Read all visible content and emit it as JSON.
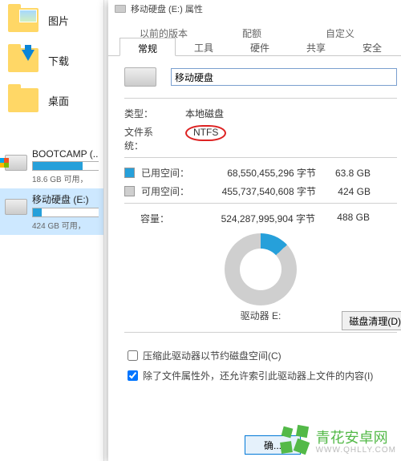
{
  "left_panel": {
    "quick": [
      {
        "label": "图片"
      },
      {
        "label": "下载"
      },
      {
        "label": "桌面"
      }
    ],
    "drives": [
      {
        "name": "BOOTCAMP (...",
        "sub": "18.6 GB 可用，",
        "pct": 76
      },
      {
        "name": "移动硬盘 (E:)",
        "sub": "424 GB 可用，",
        "pct": 13
      }
    ]
  },
  "window": {
    "title": "移动硬盘 (E:) 属性",
    "tabs_upper": [
      "以前的版本",
      "配额",
      "自定义"
    ],
    "tabs_lower": [
      "常规",
      "工具",
      "硬件",
      "共享",
      "安全"
    ],
    "drive_name": "移动硬盘",
    "kv_type_label": "类型：",
    "kv_type_val": "本地磁盘",
    "kv_fs_label": "文件系统：",
    "kv_fs_val": "NTFS",
    "used_label": "已用空间：",
    "used_bytes": "68,550,455,296 字节",
    "used_h": "63.8 GB",
    "free_label": "可用空间：",
    "free_bytes": "455,737,540,608 字节",
    "free_h": "424 GB",
    "cap_label": "容量：",
    "cap_bytes": "524,287,995,904 字节",
    "cap_h": "488 GB",
    "drive_letter": "驱动器 E:",
    "cleanup_btn": "磁盘清理(D)",
    "chk_compress": "压缩此驱动器以节约磁盘空间(C)",
    "chk_index": "除了文件属性外，还允许索引此驱动器上文件的内容(I)",
    "ok_btn": "确..."
  },
  "watermark": {
    "brand": "青花安卓网",
    "sub": "WWW.QHLLY.COM"
  }
}
